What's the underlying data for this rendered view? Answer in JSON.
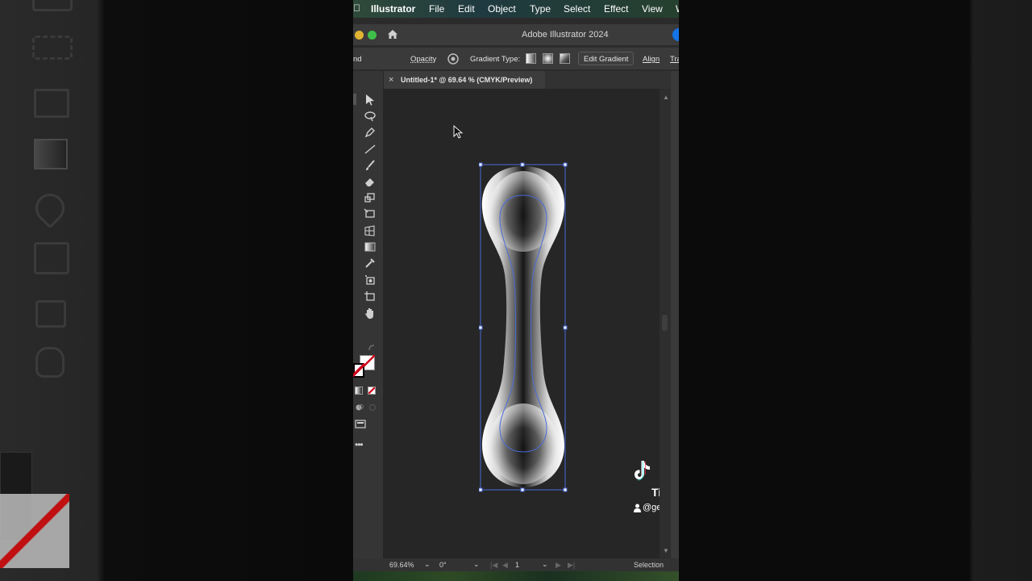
{
  "menubar": {
    "apple": "",
    "app_name": "Illustrator",
    "items": [
      "File",
      "Edit",
      "Object",
      "Type",
      "Select",
      "Effect",
      "View"
    ],
    "overflow": "W"
  },
  "window": {
    "title": "Adobe Illustrator 2024",
    "home_icon": "home-icon"
  },
  "control_bar": {
    "blend_fragment": "nd",
    "opacity_label": "Opacity",
    "gradient_type_label": "Gradient Type:",
    "edit_gradient_label": "Edit Gradient",
    "align_label": "Align",
    "transform_fragment": "Tra"
  },
  "document": {
    "tab_title": "Untitled-1* @ 69.64 % (CMYK/Preview)",
    "close_glyph": "×"
  },
  "status": {
    "zoom": "69.64%",
    "rotation": "0°",
    "artboard": "1",
    "tool": "Selection"
  },
  "tools": [
    "selection-tool-icon",
    "lasso-tool-icon",
    "pen-tool-icon",
    "line-tool-icon",
    "paintbrush-tool-icon",
    "eraser-tool-icon",
    "rotate-tool-icon",
    "free-transform-icon",
    "perspective-grid-icon",
    "gradient-tool-icon",
    "eyedropper-tool-icon",
    "symbol-sprayer-icon",
    "artboard-tool-icon",
    "hand-tool-icon"
  ],
  "overlay": {
    "brand": "TikTo",
    "handle": "@genias"
  },
  "colors": {
    "selection": "#4a6bd8",
    "accent_blue": "#1473e6",
    "stroke_red": "#d0021b"
  }
}
